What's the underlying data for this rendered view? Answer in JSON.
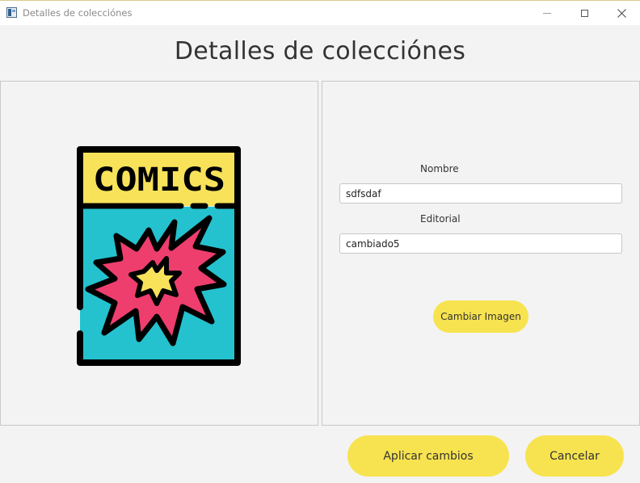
{
  "window": {
    "title": "Detalles de colecciónes"
  },
  "header": {
    "title": "Detalles de colecciónes"
  },
  "image_panel": {
    "image_icon": "comic-book-icon",
    "comic_cover_text": "COMICS",
    "colors": {
      "cover_top": "#f7e25a",
      "cover_bottom": "#24c2cf",
      "burst_outer": "#ee3e6e",
      "burst_inner": "#f7e25a",
      "outline": "#000000"
    }
  },
  "form": {
    "nombre_label": "Nombre",
    "nombre_value": "sdfsdaf",
    "editorial_label": "Editorial",
    "editorial_value": "cambiado5",
    "change_image_label": "Cambiar Imagen"
  },
  "footer": {
    "apply_label": "Aplicar cambios",
    "cancel_label": "Cancelar"
  },
  "theme": {
    "accent": "#f7e34f",
    "background": "#f3f3f3"
  }
}
